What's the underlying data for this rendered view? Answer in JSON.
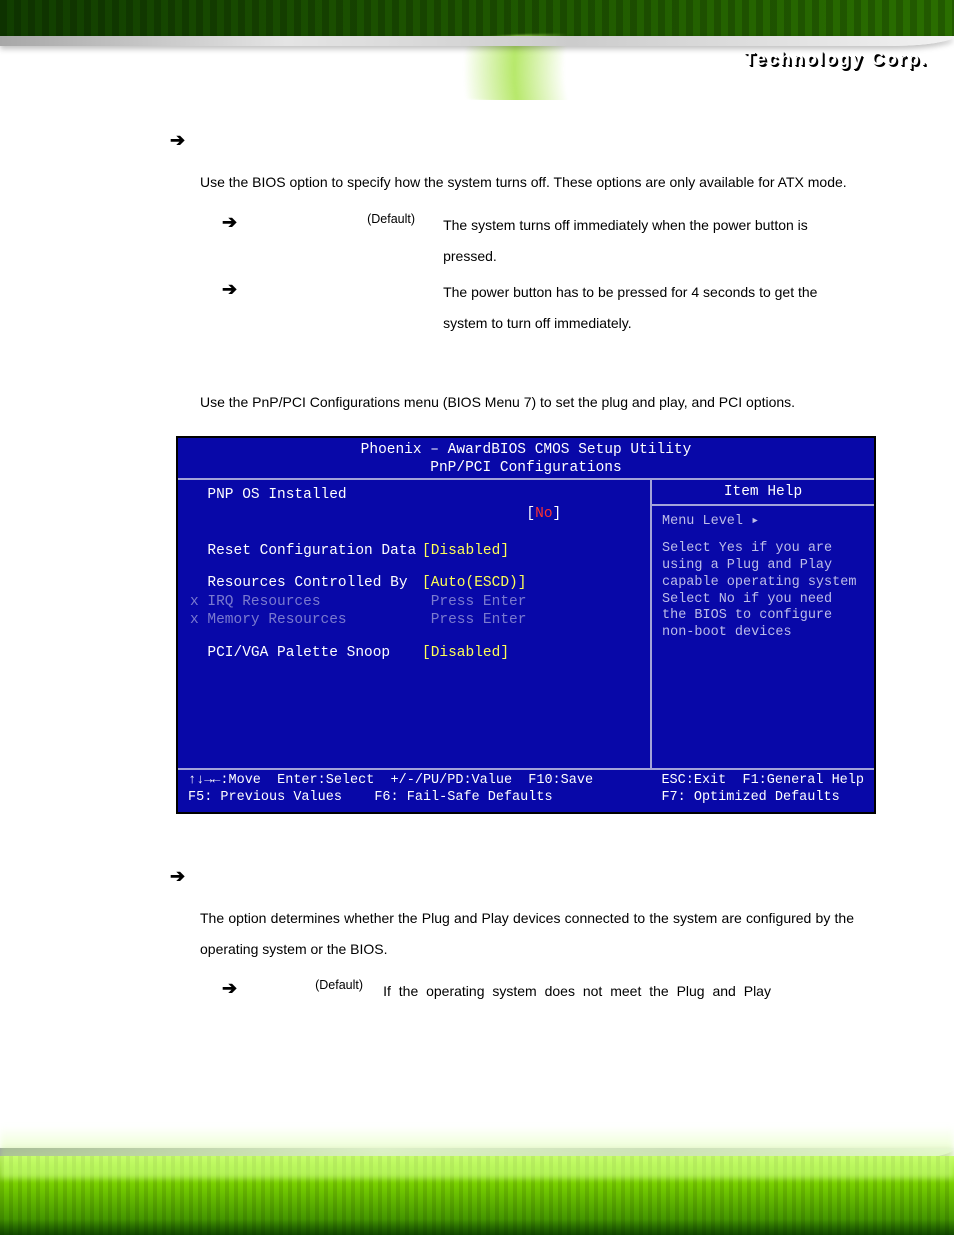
{
  "header": {
    "brand_name": "Technology Corp.",
    "reg_mark": "®"
  },
  "power_button": {
    "intro": "Use the                                   BIOS option to specify how the system turns off. These options are only available for ATX mode.",
    "opt1_default": "(Default)",
    "opt1_desc": "The system turns off immediately when the power button is pressed.",
    "opt2_desc": "The power button has to be pressed for 4 seconds to get the system to turn off immediately."
  },
  "pnp_intro": "Use the PnP/PCI Configurations menu (BIOS Menu 7) to set the plug and play, and PCI options.",
  "bios": {
    "title1": "Phoenix – AwardBIOS CMOS Setup Utility",
    "title2": "PnP/PCI Configurations",
    "rows": {
      "r1_lbl": "  PNP OS Installed",
      "r1_br_l": "[",
      "r1_val": "No",
      "r1_br_r": "]",
      "r2_lbl": "  Reset Configuration Data",
      "r2_val": "[Disabled]",
      "r3_lbl": "  Resources Controlled By",
      "r3_val": "[Auto(ESCD)]",
      "r4_lbl": "x IRQ Resources",
      "r4_val": " Press Enter",
      "r5_lbl": "x Memory Resources",
      "r5_val": " Press Enter",
      "r6_lbl": "  PCI/VGA Palette Snoop",
      "r6_val": "[Disabled]"
    },
    "help_title": "Item Help",
    "help_level": "Menu Level   ▸",
    "help_text": "Select Yes if you are using a Plug and Play capable operating system Select No if you need the BIOS to configure non-boot devices",
    "footer_left": "↑↓→←:Move  Enter:Select  +/-/PU/PD:Value  F10:Save\nF5: Previous Values    F6: Fail-Safe Defaults",
    "footer_right": "ESC:Exit  F1:General Help\nF7: Optimized Defaults"
  },
  "pnp_os": {
    "intro": "The                             option determines whether the Plug and Play devices connected to the system are configured by the operating system or the BIOS.",
    "opt1_default": "(Default)",
    "opt1_desc": "If  the  operating  system  does  not  meet  the  Plug  and  Play"
  }
}
